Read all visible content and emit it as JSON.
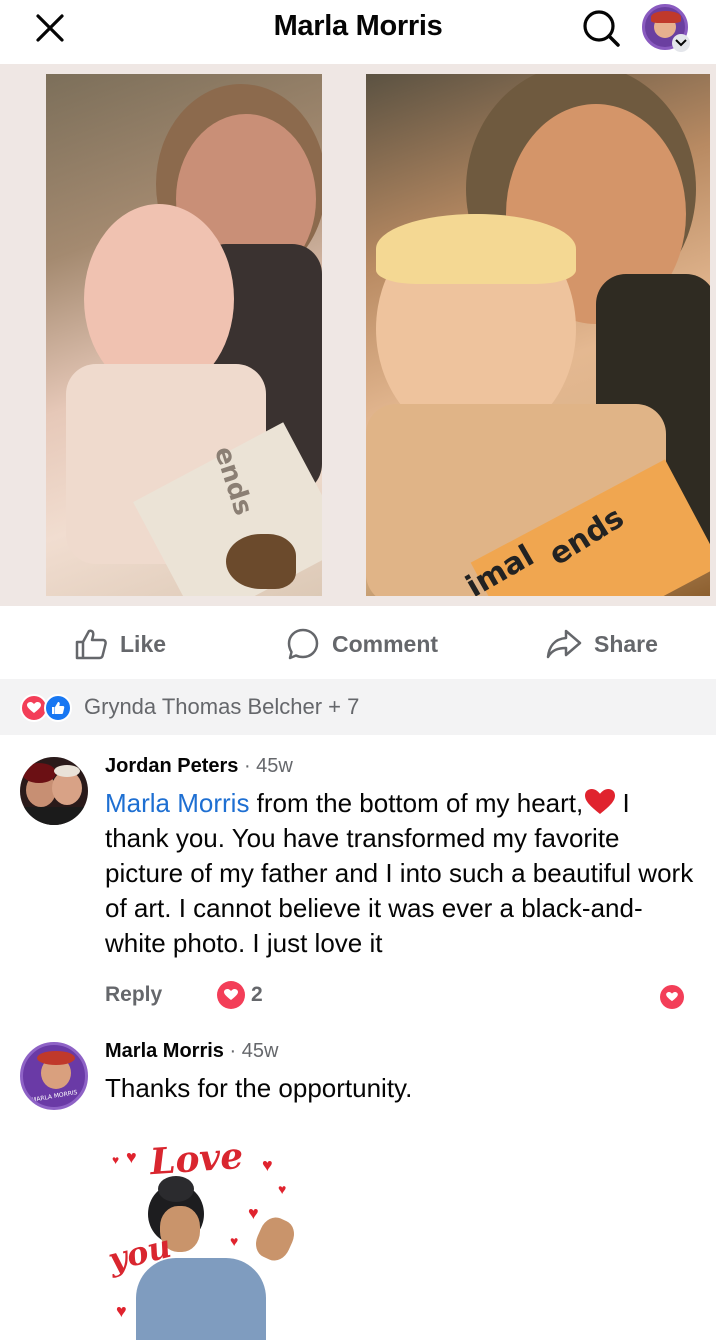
{
  "header": {
    "title": "Marla Morris",
    "close_icon": "close-icon",
    "search_icon": "search-icon"
  },
  "photos": {
    "left_book_text": "ends",
    "right_book_text_1": "imal",
    "right_book_text_2": "ends"
  },
  "actions": {
    "like_label": "Like",
    "comment_label": "Comment",
    "share_label": "Share"
  },
  "reactions": {
    "summary": "Grynda Thomas Belcher + 7"
  },
  "comments": [
    {
      "author": "Jordan Peters",
      "time": "· 45w",
      "mention": "Marla Morris",
      "text_before_heart": " from the bottom of my heart,",
      "text_after_heart": " I thank you. You have transformed my favorite picture of my father and I into such a beautiful work of art. I cannot believe it was ever a black-and-white photo. I just love it",
      "reply_label": "Reply",
      "reaction_count": "2"
    },
    {
      "author": "Marla Morris",
      "time": "· 45w",
      "text": "Thanks for the opportunity.",
      "avatar_caption": "MARLA MORRIS"
    }
  ],
  "sticker": {
    "line1": "Love",
    "line2": "you"
  },
  "colors": {
    "accent_blue": "#1877f2",
    "mention_blue": "#1e6fd2",
    "love_red": "#f33e58",
    "muted_text": "#65676b"
  }
}
